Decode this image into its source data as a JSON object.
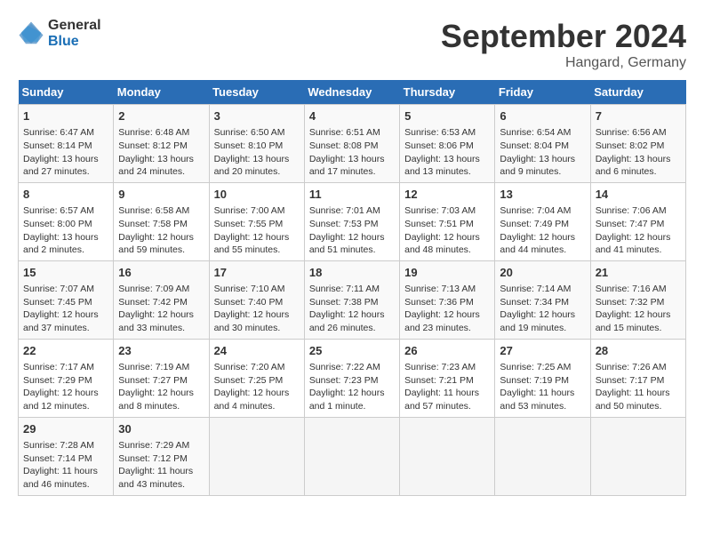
{
  "header": {
    "logo_line1": "General",
    "logo_line2": "Blue",
    "month_title": "September 2024",
    "location": "Hangard, Germany"
  },
  "days_of_week": [
    "Sunday",
    "Monday",
    "Tuesday",
    "Wednesday",
    "Thursday",
    "Friday",
    "Saturday"
  ],
  "weeks": [
    [
      {
        "day": 1,
        "info": "Sunrise: 6:47 AM\nSunset: 8:14 PM\nDaylight: 13 hours\nand 27 minutes."
      },
      {
        "day": 2,
        "info": "Sunrise: 6:48 AM\nSunset: 8:12 PM\nDaylight: 13 hours\nand 24 minutes."
      },
      {
        "day": 3,
        "info": "Sunrise: 6:50 AM\nSunset: 8:10 PM\nDaylight: 13 hours\nand 20 minutes."
      },
      {
        "day": 4,
        "info": "Sunrise: 6:51 AM\nSunset: 8:08 PM\nDaylight: 13 hours\nand 17 minutes."
      },
      {
        "day": 5,
        "info": "Sunrise: 6:53 AM\nSunset: 8:06 PM\nDaylight: 13 hours\nand 13 minutes."
      },
      {
        "day": 6,
        "info": "Sunrise: 6:54 AM\nSunset: 8:04 PM\nDaylight: 13 hours\nand 9 minutes."
      },
      {
        "day": 7,
        "info": "Sunrise: 6:56 AM\nSunset: 8:02 PM\nDaylight: 13 hours\nand 6 minutes."
      }
    ],
    [
      {
        "day": 8,
        "info": "Sunrise: 6:57 AM\nSunset: 8:00 PM\nDaylight: 13 hours\nand 2 minutes."
      },
      {
        "day": 9,
        "info": "Sunrise: 6:58 AM\nSunset: 7:58 PM\nDaylight: 12 hours\nand 59 minutes."
      },
      {
        "day": 10,
        "info": "Sunrise: 7:00 AM\nSunset: 7:55 PM\nDaylight: 12 hours\nand 55 minutes."
      },
      {
        "day": 11,
        "info": "Sunrise: 7:01 AM\nSunset: 7:53 PM\nDaylight: 12 hours\nand 51 minutes."
      },
      {
        "day": 12,
        "info": "Sunrise: 7:03 AM\nSunset: 7:51 PM\nDaylight: 12 hours\nand 48 minutes."
      },
      {
        "day": 13,
        "info": "Sunrise: 7:04 AM\nSunset: 7:49 PM\nDaylight: 12 hours\nand 44 minutes."
      },
      {
        "day": 14,
        "info": "Sunrise: 7:06 AM\nSunset: 7:47 PM\nDaylight: 12 hours\nand 41 minutes."
      }
    ],
    [
      {
        "day": 15,
        "info": "Sunrise: 7:07 AM\nSunset: 7:45 PM\nDaylight: 12 hours\nand 37 minutes."
      },
      {
        "day": 16,
        "info": "Sunrise: 7:09 AM\nSunset: 7:42 PM\nDaylight: 12 hours\nand 33 minutes."
      },
      {
        "day": 17,
        "info": "Sunrise: 7:10 AM\nSunset: 7:40 PM\nDaylight: 12 hours\nand 30 minutes."
      },
      {
        "day": 18,
        "info": "Sunrise: 7:11 AM\nSunset: 7:38 PM\nDaylight: 12 hours\nand 26 minutes."
      },
      {
        "day": 19,
        "info": "Sunrise: 7:13 AM\nSunset: 7:36 PM\nDaylight: 12 hours\nand 23 minutes."
      },
      {
        "day": 20,
        "info": "Sunrise: 7:14 AM\nSunset: 7:34 PM\nDaylight: 12 hours\nand 19 minutes."
      },
      {
        "day": 21,
        "info": "Sunrise: 7:16 AM\nSunset: 7:32 PM\nDaylight: 12 hours\nand 15 minutes."
      }
    ],
    [
      {
        "day": 22,
        "info": "Sunrise: 7:17 AM\nSunset: 7:29 PM\nDaylight: 12 hours\nand 12 minutes."
      },
      {
        "day": 23,
        "info": "Sunrise: 7:19 AM\nSunset: 7:27 PM\nDaylight: 12 hours\nand 8 minutes."
      },
      {
        "day": 24,
        "info": "Sunrise: 7:20 AM\nSunset: 7:25 PM\nDaylight: 12 hours\nand 4 minutes."
      },
      {
        "day": 25,
        "info": "Sunrise: 7:22 AM\nSunset: 7:23 PM\nDaylight: 12 hours\nand 1 minute."
      },
      {
        "day": 26,
        "info": "Sunrise: 7:23 AM\nSunset: 7:21 PM\nDaylight: 11 hours\nand 57 minutes."
      },
      {
        "day": 27,
        "info": "Sunrise: 7:25 AM\nSunset: 7:19 PM\nDaylight: 11 hours\nand 53 minutes."
      },
      {
        "day": 28,
        "info": "Sunrise: 7:26 AM\nSunset: 7:17 PM\nDaylight: 11 hours\nand 50 minutes."
      }
    ],
    [
      {
        "day": 29,
        "info": "Sunrise: 7:28 AM\nSunset: 7:14 PM\nDaylight: 11 hours\nand 46 minutes."
      },
      {
        "day": 30,
        "info": "Sunrise: 7:29 AM\nSunset: 7:12 PM\nDaylight: 11 hours\nand 43 minutes."
      },
      null,
      null,
      null,
      null,
      null
    ]
  ]
}
